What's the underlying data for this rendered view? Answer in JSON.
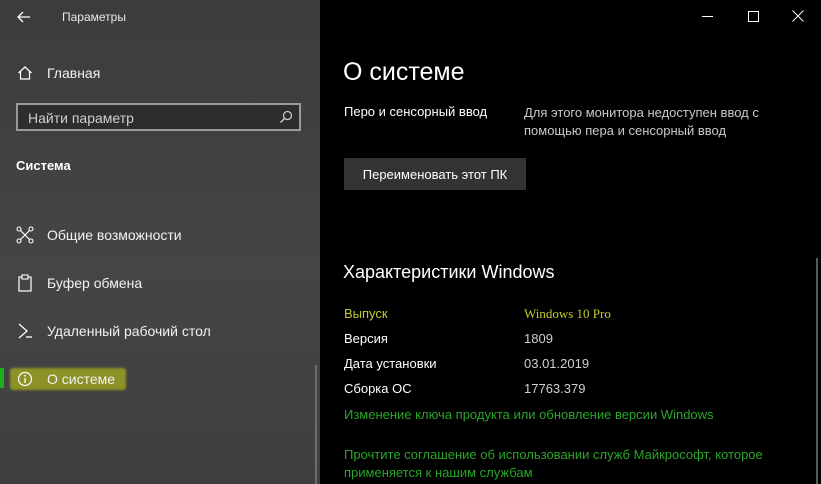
{
  "window": {
    "title": "Параметры",
    "controls": [
      "minimize",
      "maximize",
      "close"
    ]
  },
  "sidebar": {
    "home_label": "Главная",
    "search_placeholder": "Найти параметр",
    "section_title": "Система",
    "items": [
      {
        "label": "Общие возможности",
        "icon": "shared-experiences-icon"
      },
      {
        "label": "Буфер обмена",
        "icon": "clipboard-icon"
      },
      {
        "label": "Удаленный рабочий стол",
        "icon": "remote-desktop-icon"
      },
      {
        "label": "О системе",
        "icon": "info-icon",
        "selected": true
      }
    ],
    "selected_accent": "#1eae1e",
    "highlight_color": "#c9d414"
  },
  "main": {
    "title": "О системе",
    "pen_label": "Перо и сенсорный ввод",
    "pen_value": "Для этого монитора недоступен ввод с помощью пера и сенсорный ввод",
    "rename_button": "Переименовать этот ПК",
    "windows_heading": "Характеристики Windows",
    "specs": [
      {
        "key": "Выпуск",
        "value": "Windows 10 Pro",
        "highlighted": true
      },
      {
        "key": "Версия",
        "value": "1809"
      },
      {
        "key": "Дата установки",
        "value": "03.01.2019"
      },
      {
        "key": "Сборка ОС",
        "value": "17763.379"
      }
    ],
    "links": [
      "Изменение ключа продукта или обновление версии Windows",
      "Прочтите соглашение об использовании служб Майкрософт, которое применяется к нашим службам"
    ],
    "link_color": "#2aa52a",
    "highlight_text_color": "#c7c82e"
  }
}
